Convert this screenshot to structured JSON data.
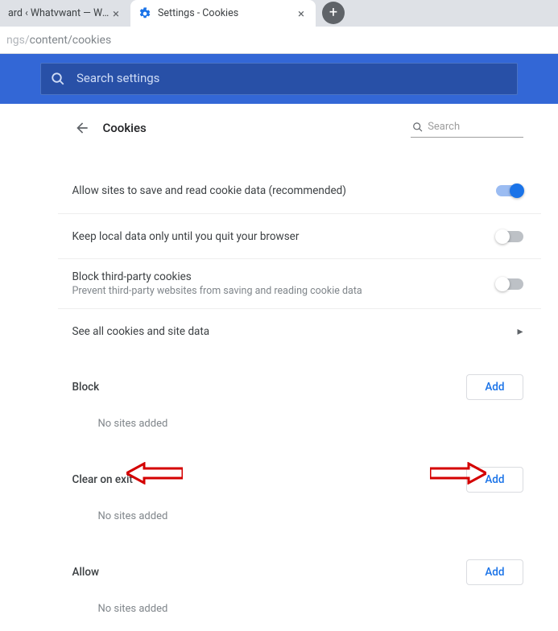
{
  "tabs": {
    "inactive_title": "ard ‹ Whatvwant — Wor",
    "active_title": "Settings - Cookies"
  },
  "address_bar": {
    "url_part1": "ngs/",
    "url_part2": "content/cookies"
  },
  "search_settings": {
    "placeholder": "Search settings"
  },
  "header": {
    "title": "Cookies",
    "search_placeholder": "Search"
  },
  "rows": {
    "allow_sites": "Allow sites to save and read cookie data (recommended)",
    "keep_local": "Keep local data only until you quit your browser",
    "block_tp_title": "Block third-party cookies",
    "block_tp_sub": "Prevent third-party websites from saving and reading cookie data",
    "see_all": "See all cookies and site data"
  },
  "sections": {
    "block": "Block",
    "clear_on_exit": "Clear on exit",
    "allow": "Allow",
    "add_label": "Add",
    "empty_text": "No sites added"
  }
}
